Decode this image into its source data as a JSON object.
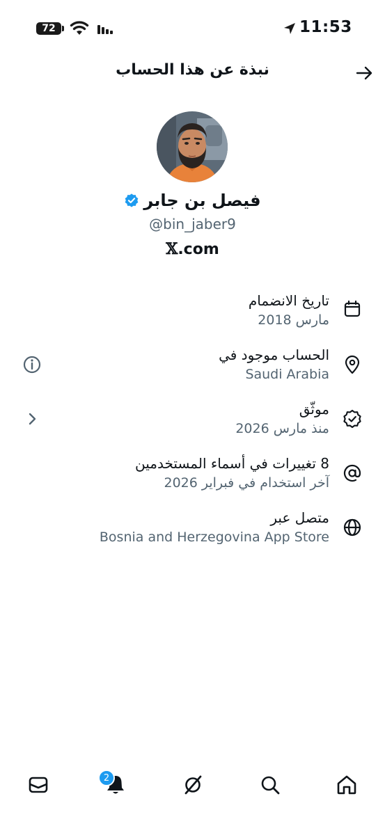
{
  "status_bar": {
    "time": "11:53",
    "battery": "72"
  },
  "header": {
    "title": "نبذة عن هذا الحساب"
  },
  "profile": {
    "name": "فيصل بن جابر",
    "handle": "@bin_jaber9",
    "website_mark": "𝕏",
    "website_rest": ".com"
  },
  "rows": [
    {
      "title": "تاريخ الانضمام",
      "subtitle": "مارس 2018",
      "icon": "calendar-icon"
    },
    {
      "title": "الحساب موجود في",
      "subtitle": "Saudi Arabia",
      "icon": "location-pin-icon"
    },
    {
      "title": "موثّق",
      "subtitle": "منذ مارس 2026",
      "icon": "verified-check-icon"
    },
    {
      "title": "8 تغييرات في أسماء المستخدمين",
      "subtitle": "آخر استخدام في فبراير 2026",
      "icon": "at-sign-icon"
    },
    {
      "title": "متصل عبر",
      "subtitle": "Bosnia and Herzegovina App Store",
      "icon": "globe-icon"
    }
  ],
  "bottom_nav": {
    "notifications_badge": "2",
    "items": [
      "mail-icon",
      "bell-icon",
      "grok-icon",
      "search-icon",
      "home-icon"
    ]
  },
  "colors": {
    "text": "#0f1419",
    "secondary": "#536471",
    "accent": "#1d9bf0"
  }
}
